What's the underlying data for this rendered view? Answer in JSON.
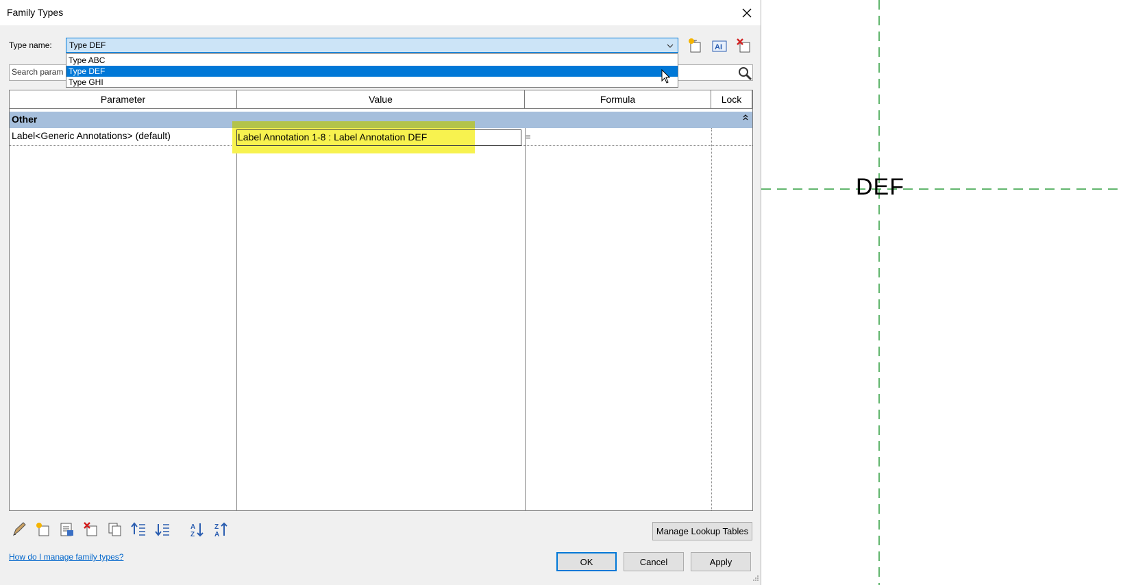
{
  "window": {
    "title": "Family Types"
  },
  "type_name": {
    "label": "Type name:",
    "value": "Type DEF",
    "options": [
      "Type ABC",
      "Type DEF",
      "Type GHI"
    ],
    "selected_index": 1
  },
  "search": {
    "text": "Search param"
  },
  "grid": {
    "headers": {
      "parameter": "Parameter",
      "value": "Value",
      "formula": "Formula",
      "lock": "Lock"
    },
    "group": "Other",
    "rows": [
      {
        "parameter": "Label<Generic Annotations> (default)",
        "value": "Label Annotation 1-8 : Label Annotation DEF",
        "formula": "="
      }
    ]
  },
  "buttons": {
    "manage_lookup": "Manage Lookup Tables",
    "ok": "OK",
    "cancel": "Cancel",
    "apply": "Apply"
  },
  "help_link": "How do I manage family types?",
  "canvas": {
    "label": "DEF"
  },
  "colors": {
    "accent": "#0078d7",
    "group_bg": "#a6bfdc",
    "highlight": "#f7f24f",
    "guide": "#2e9e3e"
  }
}
